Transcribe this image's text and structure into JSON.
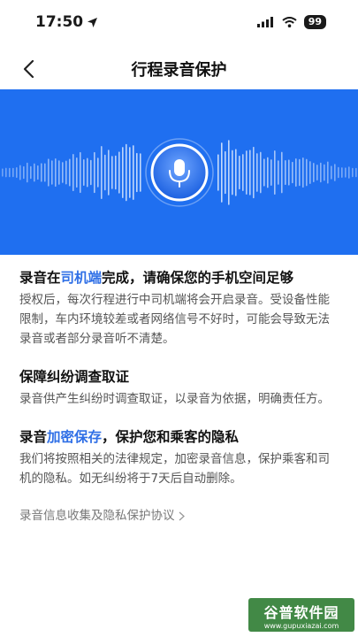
{
  "status": {
    "time": "17:50",
    "battery": "99"
  },
  "nav": {
    "title": "行程录音保护"
  },
  "sections": [
    {
      "title_parts": [
        "录音在",
        "司机端",
        "完成，请确保您的手机空间足够"
      ],
      "body": "授权后，每次行程进行中司机端将会开启录音。受设备性能限制，车内环境较差或者网络信号不好时，可能会导致无法录音或者部分录音听不清楚。"
    },
    {
      "title_parts": [
        "保障纠纷调查取证"
      ],
      "body": "录音供产生纠纷时调查取证，以录音为依据，明确责任方。"
    },
    {
      "title_parts": [
        "录音",
        "加密保存",
        "，保护您和乘客的隐私"
      ],
      "body": "我们将按照相关的法律规定，加密录音信息，保护乘客和司机的隐私。如无纠纷将于7天后自动删除。"
    }
  ],
  "link": {
    "label": "录音信息收集及隐私保护协议"
  },
  "watermark": {
    "main": "谷普软件园",
    "sub": "www.gupuxiazai.com"
  },
  "colors": {
    "banner": "#1f6ff0",
    "highlight": "#2f6fe6"
  }
}
